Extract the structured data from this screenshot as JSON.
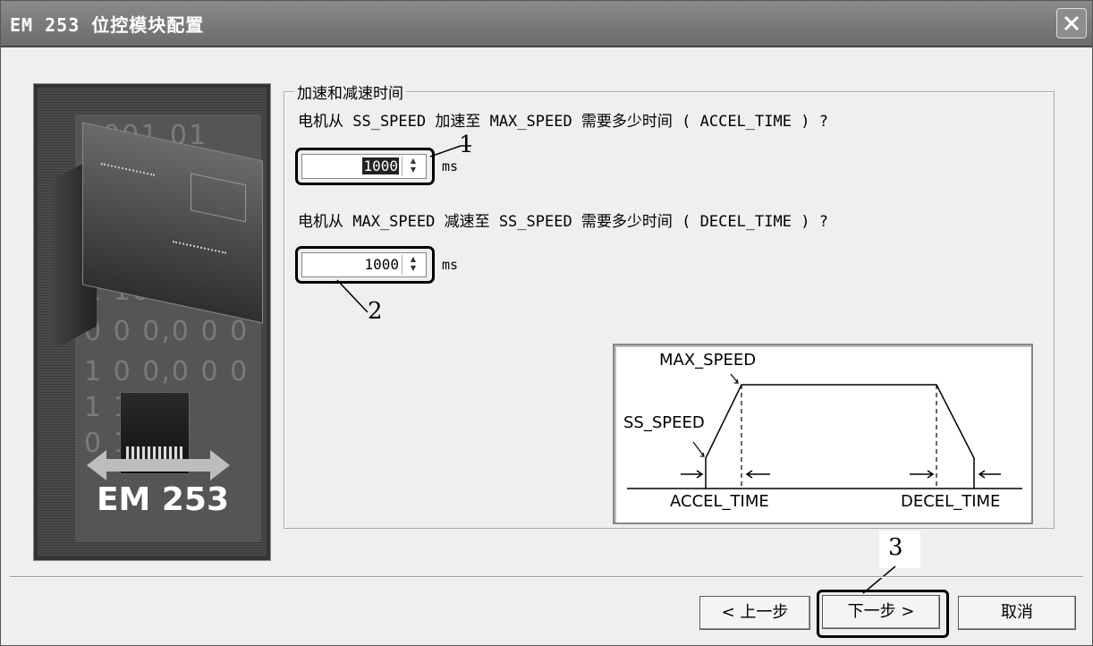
{
  "window": {
    "title": "EM 253 位控模块配置",
    "close_icon": "close-icon"
  },
  "banner": {
    "label": "EM 253",
    "binary_rows": [
      "1001  01",
      "1    101",
      "0 0 0,0 0 0",
      "1 0 0,0 0 0",
      "1  1 0",
      "0   1 0"
    ],
    "image": "plc-module-image"
  },
  "group": {
    "title": "加速和减速时间",
    "accel_question": "电机从 SS_SPEED 加速至 MAX_SPEED 需要多少时间 ( ACCEL_TIME ) ?",
    "decel_question": "电机从 MAX_SPEED 减速至 SS_SPEED 需要多少时间 ( DECEL_TIME ) ?",
    "accel_value": "1000",
    "decel_value": "1000",
    "accel_unit": "ms",
    "decel_unit": "ms"
  },
  "callouts": {
    "c1": "1",
    "c2": "2",
    "c3": "3"
  },
  "diagram": {
    "max_speed": "MAX_SPEED",
    "ss_speed": "SS_SPEED",
    "accel_time": "ACCEL_TIME",
    "decel_time": "DECEL_TIME"
  },
  "buttons": {
    "back": "< 上一步",
    "next": "下一步 >",
    "cancel": "取消"
  }
}
